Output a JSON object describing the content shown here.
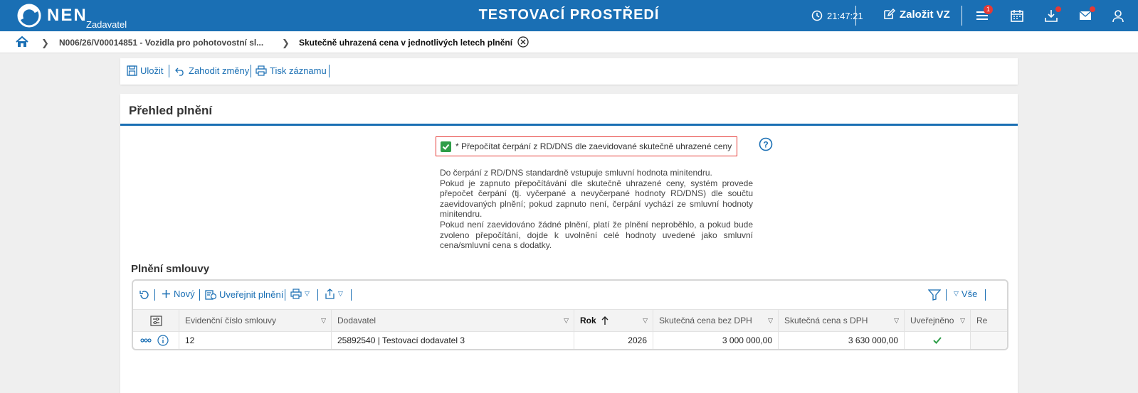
{
  "header": {
    "brand": "NEN",
    "brand_sub": "Zadavatel",
    "env_title": "TESTOVACÍ PROSTŘEDÍ",
    "time": "21:47:21",
    "create_label": "Založit VZ",
    "menu_badge": "1",
    "accent": "#1a6fb4"
  },
  "breadcrumb": {
    "item1": "N006/26/V00014851 - Vozidla pro pohotovostní sl...",
    "item2": "Skutečně uhrazená cena v jednotlivých letech plnění"
  },
  "toolbar": {
    "save": "Uložit",
    "discard": "Zahodit změny",
    "print": "Tisk záznamu"
  },
  "main": {
    "title": "Přehled plnění",
    "checkbox_label": "* Přepočítat čerpání z RD/DNS dle zaevidované skutečně uhrazené ceny",
    "checkbox_checked": true,
    "info_lines": [
      "Do čerpání z RD/DNS standardně vstupuje smluvní hodnota minitendru.",
      "Pokud je zapnuto přepočítávání dle skutečně uhrazené ceny, systém provede přepočet čerpání (tj. vyčerpané a nevyčerpané hodnoty RD/DNS) dle součtu zaevidovaných plnění; pokud zapnuto není, čerpání vychází ze smluvní hodnoty minitendru.",
      "Pokud není zaevidováno žádné plnění, platí že plnění neproběhlo, a pokud bude zvoleno přepočítání, dojde k uvolnění celé hodnoty uvedené jako smluvní cena/smluvní cena s dodatky."
    ],
    "section_title": "Plnění smlouvy"
  },
  "grid": {
    "new_label": "Nový",
    "publish_label": "Uveřejnit plnění",
    "all_label": "Vše",
    "columns": {
      "evid": "Evidenční číslo smlouvy",
      "supplier": "Dodavatel",
      "year": "Rok",
      "price_no_vat": "Skutečná cena bez DPH",
      "price_vat": "Skutečná cena s DPH",
      "published": "Uveřejněno",
      "more": "Re"
    },
    "rows": [
      {
        "evid": "12",
        "supplier": "25892540 | Testovací dodavatel 3",
        "year": "2026",
        "price_no_vat": "3 000 000,00",
        "price_vat": "3 630 000,00",
        "published": true
      }
    ]
  }
}
